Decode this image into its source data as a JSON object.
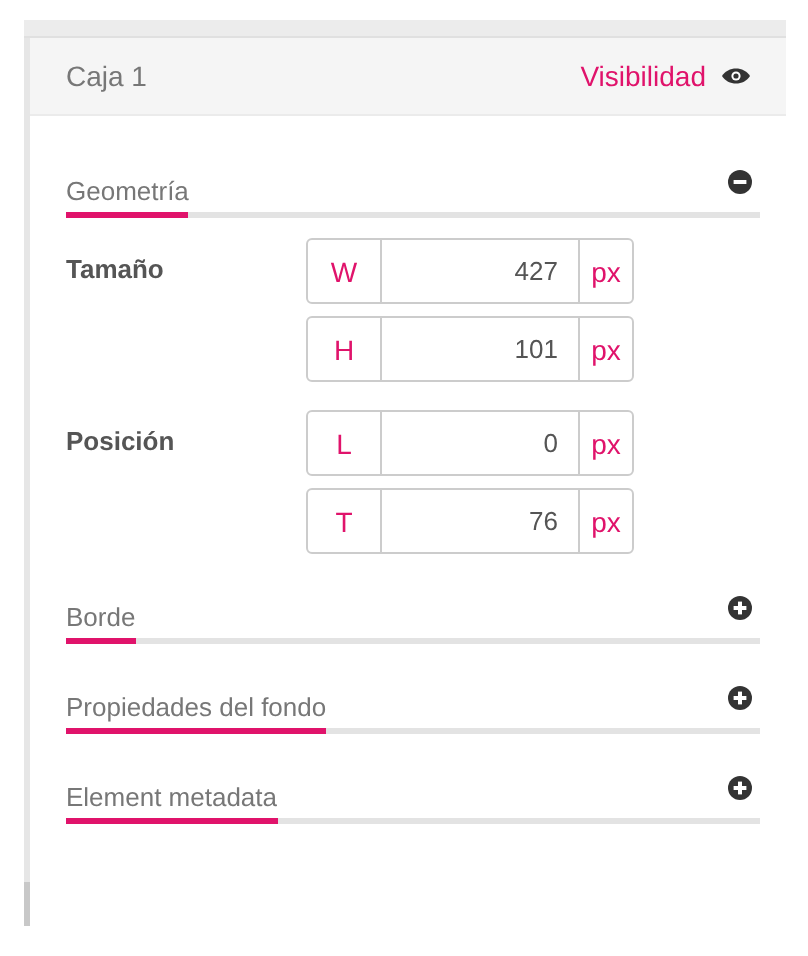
{
  "panel": {
    "title": "Caja 1",
    "visibility_label": "Visibilidad"
  },
  "sections": [
    {
      "title": "Geometría",
      "expanded": true,
      "groups": [
        {
          "label": "Tamaño",
          "fields": [
            {
              "prefix": "W",
              "value": "427",
              "unit": "px"
            },
            {
              "prefix": "H",
              "value": "101",
              "unit": "px"
            }
          ]
        },
        {
          "label": "Posición",
          "fields": [
            {
              "prefix": "L",
              "value": "0",
              "unit": "px"
            },
            {
              "prefix": "T",
              "value": "76",
              "unit": "px"
            }
          ]
        }
      ]
    },
    {
      "title": "Borde",
      "expanded": false
    },
    {
      "title": "Propiedades del fondo",
      "expanded": false
    },
    {
      "title": "Element metadata",
      "expanded": false
    }
  ]
}
